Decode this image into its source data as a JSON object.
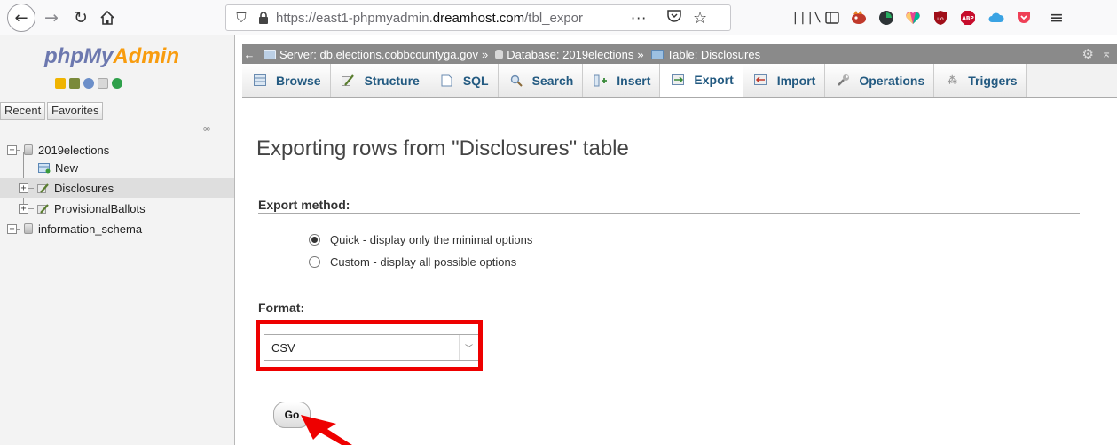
{
  "browser": {
    "url_prefix": "https://east1-phpmyadmin.",
    "url_domain": "dreamhost.com",
    "url_path": "/tbl_expor",
    "more_label": "···"
  },
  "pma": {
    "logo_php": "php",
    "logo_my": "My",
    "logo_admin": "Admin",
    "recent_tab": "Recent",
    "favorites_tab": "Favorites",
    "tree": [
      {
        "label": "2019elections",
        "expander": "−"
      },
      {
        "label": "New"
      },
      {
        "label": "Disclosures",
        "expander": "+"
      },
      {
        "label": "ProvisionalBallots",
        "expander": "+"
      },
      {
        "label": "information_schema",
        "expander": "+"
      }
    ]
  },
  "breadcrumb": {
    "server": "Server: db.elections.cobbcountyga.gov",
    "database": "Database: 2019elections",
    "table": "Table: Disclosures",
    "separator": "»"
  },
  "tabs": [
    {
      "label": "Browse",
      "active": false
    },
    {
      "label": "Structure",
      "active": false
    },
    {
      "label": "SQL",
      "active": false
    },
    {
      "label": "Search",
      "active": false
    },
    {
      "label": "Insert",
      "active": false
    },
    {
      "label": "Export",
      "active": true
    },
    {
      "label": "Import",
      "active": false
    },
    {
      "label": "Operations",
      "active": false
    },
    {
      "label": "Triggers",
      "active": false
    }
  ],
  "export": {
    "title": "Exporting rows from \"Disclosures\" table",
    "method_heading": "Export method:",
    "option_quick": "Quick - display only the minimal options",
    "option_custom": "Custom - display all possible options",
    "selected_method": "quick",
    "format_heading": "Format:",
    "format_value": "CSV",
    "go_label": "Go"
  },
  "colors": {
    "highlight": "#ee0000",
    "logo_php": "#6c78af",
    "logo_admin": "#f89c0e",
    "tab_text": "#235a81"
  }
}
